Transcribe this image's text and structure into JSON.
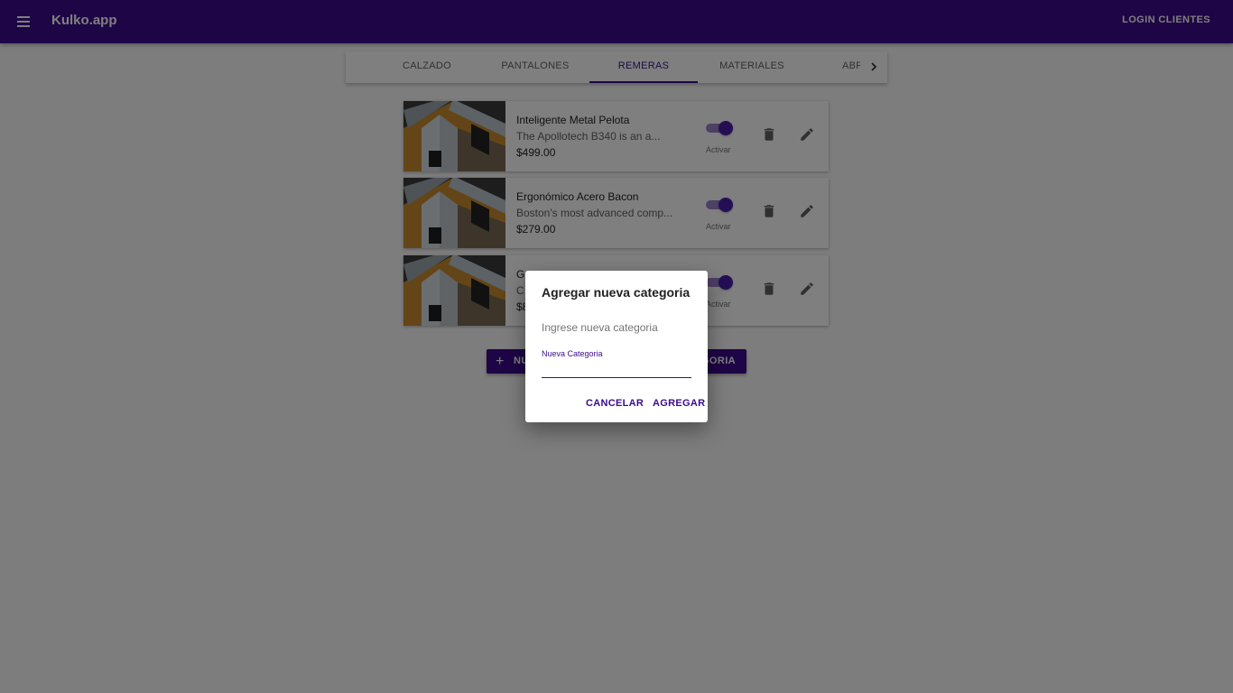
{
  "appbar": {
    "title": "Kulko.app",
    "login_label": "LOGIN CLIENTES",
    "menu_icon": "menu-icon"
  },
  "tabs": [
    {
      "label": "CALZADO",
      "active": false
    },
    {
      "label": "PANTALONES",
      "active": false
    },
    {
      "label": "REMERAS",
      "active": true
    },
    {
      "label": "MATERIALES",
      "active": false
    },
    {
      "label": "ABR",
      "active": false
    }
  ],
  "tabs_next_icon": "chevron-right-icon",
  "products": [
    {
      "name": "Inteligente Metal Pelota",
      "description": "The Apollotech B340 is an a...",
      "price": "$499.00",
      "toggle_label": "Activar",
      "active": true
    },
    {
      "name": "Ergonómico Acero Bacon",
      "description": "Boston's most advanced comp...",
      "price": "$279.00",
      "toggle_label": "Activar",
      "active": true
    },
    {
      "name": "G",
      "description": "C",
      "price": "$8",
      "toggle_label": "Activar",
      "active": true
    }
  ],
  "new_category_button": {
    "icon": "plus-icon",
    "label_visible_left": "NU",
    "label_visible_right": "GORIA"
  },
  "dialog": {
    "title": "Agregar nueva categoria",
    "text": "Ingrese nueva categoria",
    "field_label": "Nueva Categoria",
    "field_value": "",
    "cancel_label": "CANCELAR",
    "add_label": "AGREGAR"
  },
  "colors": {
    "primary": "#3c0a8c",
    "switch_track": "#9c7fc8",
    "switch_knob": "#4a1fa8",
    "overlay": "rgba(0,0,0,0.5)"
  }
}
